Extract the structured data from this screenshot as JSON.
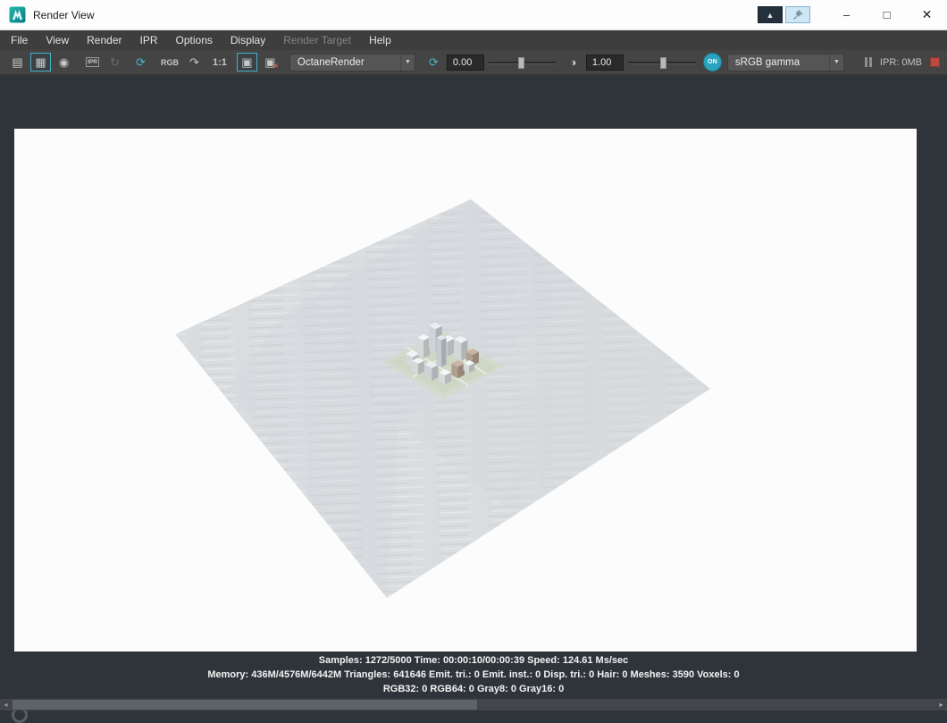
{
  "window": {
    "title": "Render View"
  },
  "icons": {
    "dock": "▲",
    "minimize": "–",
    "maximize": "□",
    "close": "✕",
    "render": "▤",
    "redo_render": "▦",
    "snapshot": "◉",
    "refresh_disabled": "↻",
    "region_refresh": "⟳",
    "flip": "↷",
    "keep_image": "▣",
    "remove_image": "▣",
    "remove_x": "✕",
    "reset_exposure": "⟳",
    "contrast": "◑",
    "dropdown_arrow": "▼",
    "scroll_left": "◂",
    "scroll_right": "▸"
  },
  "menubar": {
    "items": [
      {
        "label": "File"
      },
      {
        "label": "View"
      },
      {
        "label": "Render"
      },
      {
        "label": "IPR"
      },
      {
        "label": "Options"
      },
      {
        "label": "Display"
      },
      {
        "label": "Render Target",
        "disabled": true
      },
      {
        "label": "Help"
      }
    ]
  },
  "toolbar": {
    "ipr_icon_label": "IPR",
    "rgb_label": "RGB",
    "ratio_label": "1:1",
    "renderer": "OctaneRender",
    "exposure": "0.00",
    "gamma": "1.00",
    "toggle_on": "ON",
    "colorspace": "sRGB gamma",
    "ipr_memory": "IPR: 0MB"
  },
  "status": {
    "line1": "Samples: 1272/5000 Time: 00:00:10/00:00:39 Speed: 124.61 Ms/sec",
    "line2": "Memory: 436M/4576M/6442M Triangles: 641646 Emit. tri.: 0 Emit. inst.: 0 Disp. tri.: 0 Hair: 0 Meshes: 3590 Voxels: 0",
    "line3": "RGB32: 0 RGB64: 0 Gray8: 0 Gray16: 0"
  },
  "colors": {
    "accent_teal": "#3fb0c6",
    "stop_red": "#bb4a40",
    "toolbar_bg": "#444444",
    "viewport_bg": "#2e343a",
    "titlebar_bg": "#fdfdfd"
  }
}
